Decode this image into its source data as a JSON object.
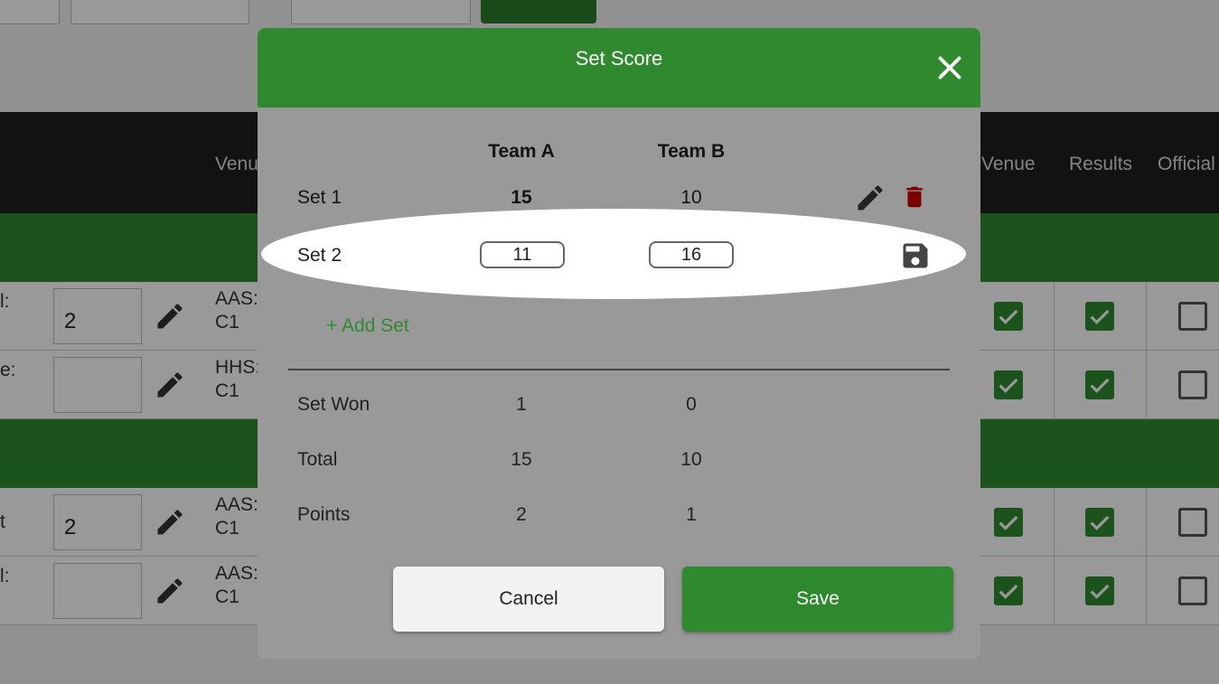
{
  "background": {
    "table_headers": {
      "venue_left": "Venu",
      "venue": "Venue",
      "results": "Results",
      "officials": "Official"
    },
    "rows": [
      {
        "label": "l:",
        "value": "2",
        "code_line1": "AAS:",
        "code_line2": "C1",
        "venue_checked": true,
        "results_checked": true,
        "officials_checked": false
      },
      {
        "label": "e:",
        "value": "",
        "code_line1": "HHS:",
        "code_line2": "C1",
        "venue_checked": true,
        "results_checked": true,
        "officials_checked": false
      },
      {
        "label": "t",
        "value": "2",
        "code_line1": "AAS:",
        "code_line2": "C1",
        "venue_checked": true,
        "results_checked": true,
        "officials_checked": false
      },
      {
        "label": "l:",
        "value": "",
        "code_line1": "AAS:",
        "code_line2": "C1",
        "venue_checked": true,
        "results_checked": true,
        "officials_checked": false
      }
    ]
  },
  "modal": {
    "title": "Set Score",
    "columns": {
      "team_a": "Team A",
      "team_b": "Team B"
    },
    "sets": [
      {
        "label": "Set 1",
        "team_a": "15",
        "team_b": "10"
      },
      {
        "label": "Set 2",
        "team_a": "11",
        "team_b": "16"
      }
    ],
    "add_set_label": "+ Add Set",
    "summary": [
      {
        "label": "Set Won",
        "team_a": "1",
        "team_b": "0"
      },
      {
        "label": "Total",
        "team_a": "15",
        "team_b": "10"
      },
      {
        "label": "Points",
        "team_a": "2",
        "team_b": "1"
      }
    ],
    "cancel_label": "Cancel",
    "save_label": "Save"
  },
  "colors": {
    "brand_green": "#2f8a2f",
    "delete_red": "#cc0000",
    "header_dark": "#1e1e1e"
  },
  "icons": {
    "close": "close-icon",
    "edit": "pencil-icon",
    "delete": "trash-icon",
    "save_set": "floppy-disk-icon",
    "check": "check-icon"
  }
}
